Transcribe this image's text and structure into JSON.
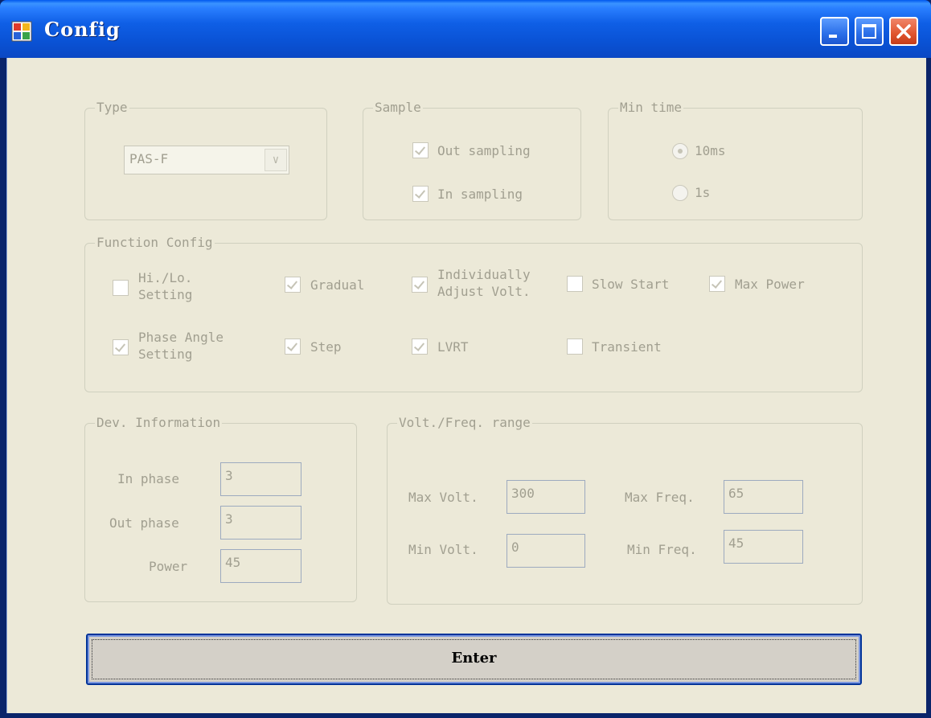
{
  "window": {
    "title": "Config"
  },
  "type_group": {
    "legend": "Type",
    "combo_value": "PAS-F"
  },
  "sample_group": {
    "legend": "Sample",
    "out_sampling": {
      "label": "Out sampling",
      "checked": true
    },
    "in_sampling": {
      "label": "In sampling",
      "checked": true
    }
  },
  "min_time_group": {
    "legend": "Min time",
    "opt_10ms": {
      "label": "10ms",
      "selected": true
    },
    "opt_1s": {
      "label": "1s",
      "selected": false
    }
  },
  "function_config": {
    "legend": "Function Config",
    "items": [
      {
        "label_line1": "Hi./Lo.",
        "label_line2": "Setting",
        "checked": false
      },
      {
        "label_line1": "Gradual",
        "label_line2": "",
        "checked": true
      },
      {
        "label_line1": "Individually",
        "label_line2": "Adjust Volt.",
        "checked": true
      },
      {
        "label_line1": "Slow Start",
        "label_line2": "",
        "checked": false
      },
      {
        "label_line1": "Max Power",
        "label_line2": "",
        "checked": true
      },
      {
        "label_line1": "Phase Angle",
        "label_line2": "Setting",
        "checked": true
      },
      {
        "label_line1": "Step",
        "label_line2": "",
        "checked": true
      },
      {
        "label_line1": "LVRT",
        "label_line2": "",
        "checked": true
      },
      {
        "label_line1": "Transient",
        "label_line2": "",
        "checked": false
      }
    ]
  },
  "dev_info": {
    "legend": "Dev. Information",
    "in_phase": {
      "label": "In phase",
      "value": "3"
    },
    "out_phase": {
      "label": "Out phase",
      "value": "3"
    },
    "power": {
      "label": "Power",
      "value": "45"
    }
  },
  "range_group": {
    "legend": "Volt./Freq. range",
    "max_volt": {
      "label": "Max Volt.",
      "value": "300"
    },
    "min_volt": {
      "label": "Min Volt.",
      "value": "0"
    },
    "max_freq": {
      "label": "Max Freq.",
      "value": "65"
    },
    "min_freq": {
      "label": "Min Freq.",
      "value": "45"
    }
  },
  "enter_button": {
    "label": "Enter"
  }
}
